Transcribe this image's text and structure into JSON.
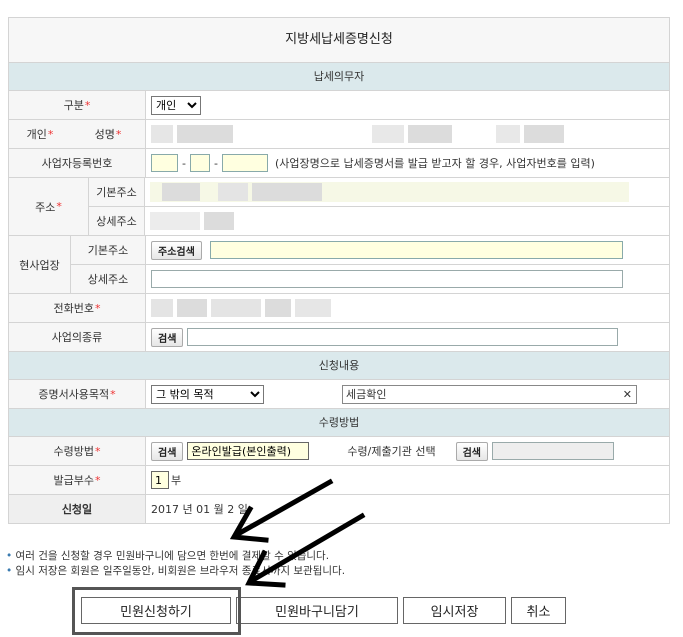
{
  "form": {
    "title": "지방세납세증명신청",
    "sections": {
      "taxpayer": "납세의무자",
      "request": "신청내용",
      "receipt": "수령방법"
    },
    "labels": {
      "category": "구분",
      "individual": "개인",
      "name": "성명",
      "bizno": "사업자등록번호",
      "address": "주소",
      "base_address": "기본주소",
      "detail_address": "상세주소",
      "current_place": "현사업장",
      "phone": "전화번호",
      "biz_type": "사업의종류",
      "purpose": "증명서사용목적",
      "receive_method": "수령방법",
      "agency_select": "수령/제출기관 선택",
      "copies": "발급부수",
      "apply_date": "신청일"
    },
    "required_mark": "*",
    "category_value": "개인",
    "bizno_note": "(사업장명으로 납세증명서를 발급 받고자 할 경우, 사업자번호를 입력)",
    "bizno_dash": "-",
    "address_search_btn": "주소검색",
    "search_btn": "검색",
    "purpose_select": "그 밖의 목적",
    "purpose_value": "세금확인",
    "clear_mark": "✕",
    "receive_value": "온라인발급(본인출력)",
    "copies_value": "1",
    "copies_unit": "부",
    "date_value": "2017 년 01 월 2 일"
  },
  "notes": [
    "여러 건을 신청할 경우 민원바구니에 담으면 한번에 결제할 수 있습니다.",
    "임시 저장은 회원은 일주일동안, 비회원은 브라우저 종료시까지 보관됩니다."
  ],
  "buttons": {
    "apply": "민원신청하기",
    "cart": "민원바구니담기",
    "temp_save": "임시저장",
    "cancel": "취소"
  }
}
